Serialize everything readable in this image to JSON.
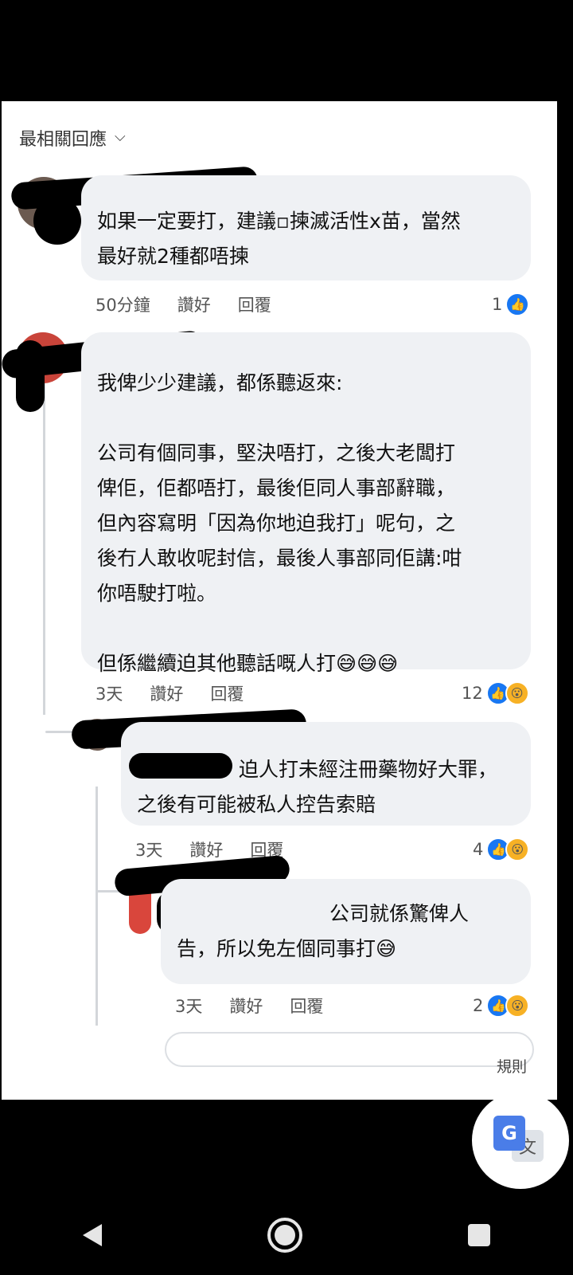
{
  "header": {
    "sort_label": "最相關回應"
  },
  "comments": [
    {
      "text": "如果一定要打，建議▫揀滅活性x苗，當然\n最好就2種都唔揀",
      "time": "50分鐘",
      "like": "讚好",
      "reply": "回覆",
      "count": "1"
    },
    {
      "text": "我俾少少建議，都係聽返來:\n\n公司有個同事，堅決唔打，之後大老闆打\n俾佢，佢都唔打，最後佢同人事部辭職，\n但內容寫明「因為你地迫我打」呢句，之\n後冇人敢收呢封信，最後人事部同佢講:咁\n你唔駛打啦。\n\n但係繼續迫其他聽話嘅人打😅😅😅",
      "time": "3天",
      "like": "讚好",
      "reply": "回覆",
      "count": "12"
    },
    {
      "text": "迫人打未經注冊藥物好大罪，\n之後有可能被私人控告索賠",
      "time": "3天",
      "like": "讚好",
      "reply": "回覆",
      "count": "4"
    },
    {
      "text": "公司就係驚俾人\n告，所以免左個同事打😅",
      "time": "3天",
      "like": "讚好",
      "reply": "回覆",
      "count": "2"
    }
  ],
  "footer": {
    "rules_label": "規則"
  },
  "icons": [
    "chevron-down-icon",
    "like-icon",
    "wow-icon",
    "translate-icon",
    "nav-back-icon",
    "nav-home-icon",
    "nav-recent-icon"
  ]
}
